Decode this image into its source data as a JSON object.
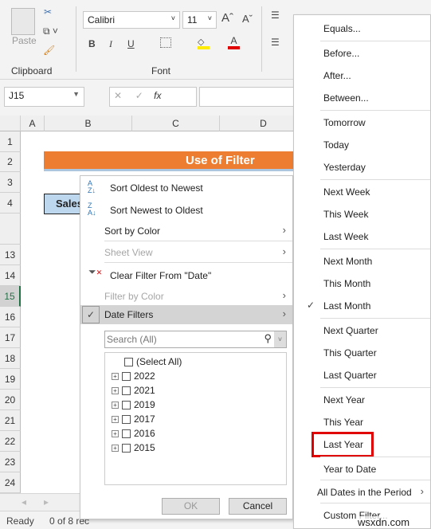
{
  "ribbon": {
    "clipboard": {
      "paste": "Paste",
      "label": "Clipboard"
    },
    "font": {
      "name": "Calibri",
      "size": "11",
      "label": "Font",
      "bold": "B",
      "italic": "I",
      "underline": "U"
    }
  },
  "formula_bar": {
    "name_box": "J15",
    "fx": "fx",
    "value": ""
  },
  "columns": [
    "A",
    "B",
    "C",
    "D"
  ],
  "rows": [
    "1",
    "2",
    "3",
    "4",
    "13",
    "14",
    "15",
    "16",
    "17",
    "18",
    "19",
    "20",
    "21",
    "22",
    "23",
    "24"
  ],
  "sheet": {
    "title": "Use of Filter",
    "header_cell": "Sales",
    "title_color": "#ed7d31",
    "header_color": "#bdd7ee"
  },
  "filter_menu": {
    "items": [
      "Sort Oldest to Newest",
      "Sort Newest to Oldest",
      "Sort by Color",
      "Sheet View",
      "Clear Filter From \"Date\"",
      "Filter by Color",
      "Date Filters"
    ],
    "search_placeholder": "Search (All)",
    "list": [
      "(Select All)",
      "2022",
      "2021",
      "2019",
      "2017",
      "2016",
      "2015"
    ],
    "ok": "OK",
    "cancel": "Cancel"
  },
  "date_filters": {
    "items": [
      "Equals...",
      "Before...",
      "After...",
      "Between...",
      "Tomorrow",
      "Today",
      "Yesterday",
      "Next Week",
      "This Week",
      "Last Week",
      "Next Month",
      "This Month",
      "Last Month",
      "Next Quarter",
      "This Quarter",
      "Last Quarter",
      "Next Year",
      "This Year",
      "Last Year",
      "Year to Date",
      "All Dates in the Period",
      "Custom Filter..."
    ],
    "checked": "Last Month",
    "highlighted": "Last Year",
    "highlight_color": "#e00000"
  },
  "status": {
    "ready": "Ready",
    "records": "0 of 8 rec"
  },
  "watermark": "wsxdn.com"
}
